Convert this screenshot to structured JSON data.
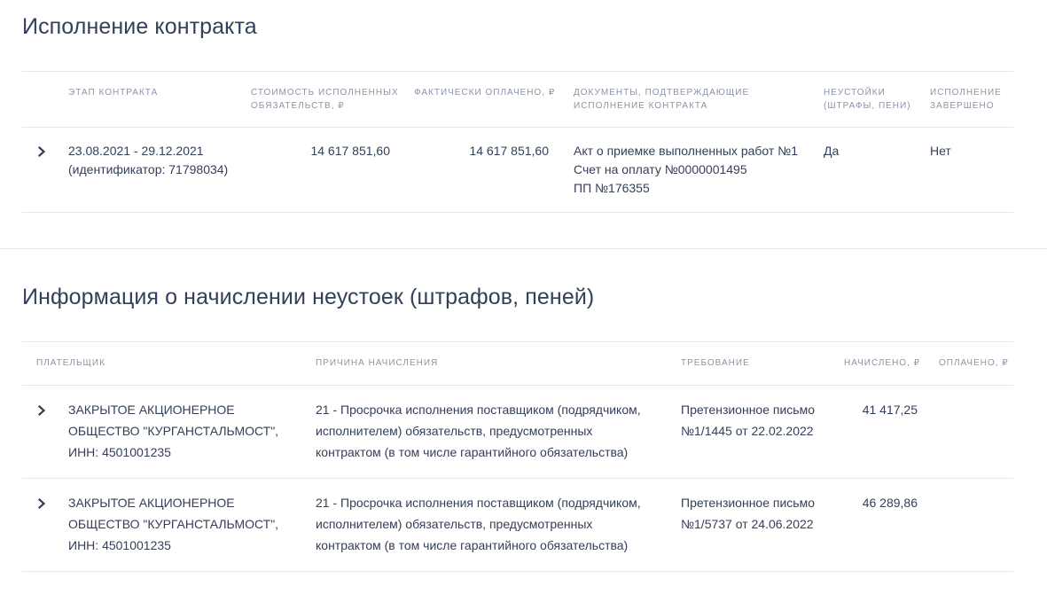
{
  "contract_execution": {
    "title": "Исполнение контракта",
    "headers": {
      "stage": "ЭТАП КОНТРАКТА",
      "cost_line1": "СТОИМОСТЬ ИСПОЛНЕННЫХ",
      "cost_line2": "ОБЯЗАТЕЛЬСТВ, ₽",
      "paid": "ФАКТИЧЕСКИ ОПЛАЧЕНО, ₽",
      "docs_line1": "ДОКУМЕНТЫ, ПОДТВЕРЖДАЮЩИЕ",
      "docs_line2": "ИСПОЛНЕНИЕ КОНТРАКТА",
      "penalty_line1": "НЕУСТОЙКИ",
      "penalty_line2": "(ШТРАФЫ, ПЕНИ)",
      "done_line1": "ИСПОЛНЕНИЕ",
      "done_line2": "ЗАВЕРШЕНО"
    },
    "rows": [
      {
        "stage_dates": "23.08.2021 - 29.12.2021",
        "stage_id": "(идентификатор: 71798034)",
        "cost": "14 617 851,60",
        "paid": "14 617 851,60",
        "docs": [
          "Акт о приемке выполненных работ №1",
          "Счет на оплату №0000001495",
          "ПП №176355"
        ],
        "penalties": "Да",
        "completed": "Нет"
      }
    ]
  },
  "penalties_info": {
    "title": "Информация о начислении неустоек (штрафов, пеней)",
    "headers": {
      "payer": "ПЛАТЕЛЬЩИК",
      "reason": "ПРИЧИНА НАЧИСЛЕНИЯ",
      "demand": "ТРЕБОВАНИЕ",
      "accrued": "НАЧИСЛЕНО, ₽",
      "paid": "ОПЛАЧЕНО, ₽"
    },
    "rows": [
      {
        "payer": [
          "ЗАКРЫТОЕ АКЦИОНЕРНОЕ",
          "ОБЩЕСТВО \"КУРГАНСТАЛЬМОСТ\",",
          "ИНН: 4501001235"
        ],
        "reason": [
          "21 - Просрочка исполнения поставщиком (подрядчиком,",
          "исполнителем) обязательств, предусмотренных",
          "контрактом (в том числе гарантийного обязательства)"
        ],
        "demand": [
          "Претензионное письмо",
          "№1/1445 от 22.02.2022"
        ],
        "accrued": "41 417,25"
      },
      {
        "payer": [
          "ЗАКРЫТОЕ АКЦИОНЕРНОЕ",
          "ОБЩЕСТВО \"КУРГАНСТАЛЬМОСТ\",",
          "ИНН: 4501001235"
        ],
        "reason": [
          "21 - Просрочка исполнения поставщиком (подрядчиком,",
          "исполнителем) обязательств, предусмотренных",
          "контрактом (в том числе гарантийного обязательства)"
        ],
        "demand": [
          "Претензионное письмо",
          "№1/5737 от 24.06.2022"
        ],
        "accrued": "46 289,86"
      }
    ]
  }
}
